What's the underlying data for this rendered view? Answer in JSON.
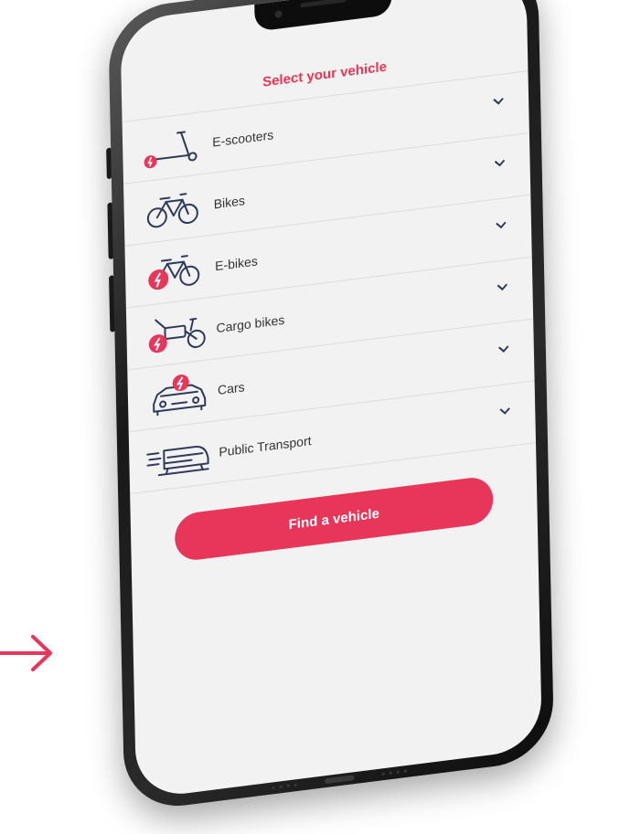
{
  "screen": {
    "title": "Select your vehicle",
    "vehicles": [
      {
        "label": "E-scooters",
        "icon": "e-scooter-icon"
      },
      {
        "label": "Bikes",
        "icon": "bike-icon"
      },
      {
        "label": "E-bikes",
        "icon": "e-bike-icon"
      },
      {
        "label": "Cargo bikes",
        "icon": "cargo-bike-icon"
      },
      {
        "label": "Cars",
        "icon": "car-icon"
      },
      {
        "label": "Public Transport",
        "icon": "train-icon"
      }
    ],
    "cta_label": "Find a vehicle"
  },
  "colors": {
    "accent": "#e8365a",
    "text": "#333333",
    "screen_bg": "#f2f2f2",
    "frame": "#1a1a1a"
  },
  "decor": {
    "arrow_icon": "arrow-right-icon"
  }
}
